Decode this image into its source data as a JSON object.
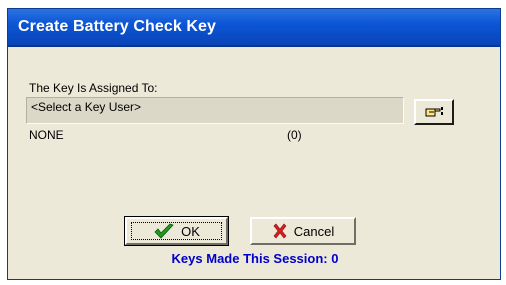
{
  "window": {
    "title": "Create Battery Check Key"
  },
  "assignment": {
    "label": "The Key Is Assigned To:",
    "user_field_value": "<Select a Key User>",
    "picker_icon": "pointing-hand-icon"
  },
  "status": {
    "name": "NONE",
    "count": "(0)"
  },
  "buttons": {
    "ok_label": "OK",
    "ok_icon": "green-checkmark-icon",
    "cancel_label": "Cancel",
    "cancel_icon": "red-x-icon"
  },
  "session": {
    "text": "Keys Made This Session: 0"
  },
  "colors": {
    "titlebar": "#0a4bc4",
    "dialog_bg": "#ece9d8",
    "session_text": "#0000c8"
  }
}
